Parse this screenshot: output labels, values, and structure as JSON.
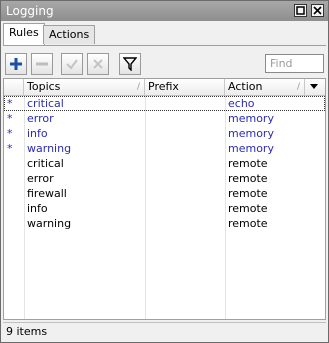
{
  "window": {
    "title": "Logging"
  },
  "tabs": [
    {
      "label": "Rules"
    },
    {
      "label": "Actions"
    }
  ],
  "toolbar": {
    "find_placeholder": "Find"
  },
  "table": {
    "columns": [
      "Topics",
      "Prefix",
      "Action"
    ],
    "rows": [
      {
        "flag": "*",
        "topics": "critical",
        "prefix": "",
        "action": "echo"
      },
      {
        "flag": "*",
        "topics": "error",
        "prefix": "",
        "action": "memory"
      },
      {
        "flag": "*",
        "topics": "info",
        "prefix": "",
        "action": "memory"
      },
      {
        "flag": "*",
        "topics": "warning",
        "prefix": "",
        "action": "memory"
      },
      {
        "flag": "",
        "topics": "critical",
        "prefix": "",
        "action": "remote"
      },
      {
        "flag": "",
        "topics": "error",
        "prefix": "",
        "action": "remote"
      },
      {
        "flag": "",
        "topics": "firewall",
        "prefix": "",
        "action": "remote"
      },
      {
        "flag": "",
        "topics": "info",
        "prefix": "",
        "action": "remote"
      },
      {
        "flag": "",
        "topics": "warning",
        "prefix": "",
        "action": "remote"
      }
    ]
  },
  "status": {
    "text": "9 items"
  },
  "colors": {
    "dynamic_row": "#2b2bb5",
    "add_icon": "#1a4fa8"
  }
}
